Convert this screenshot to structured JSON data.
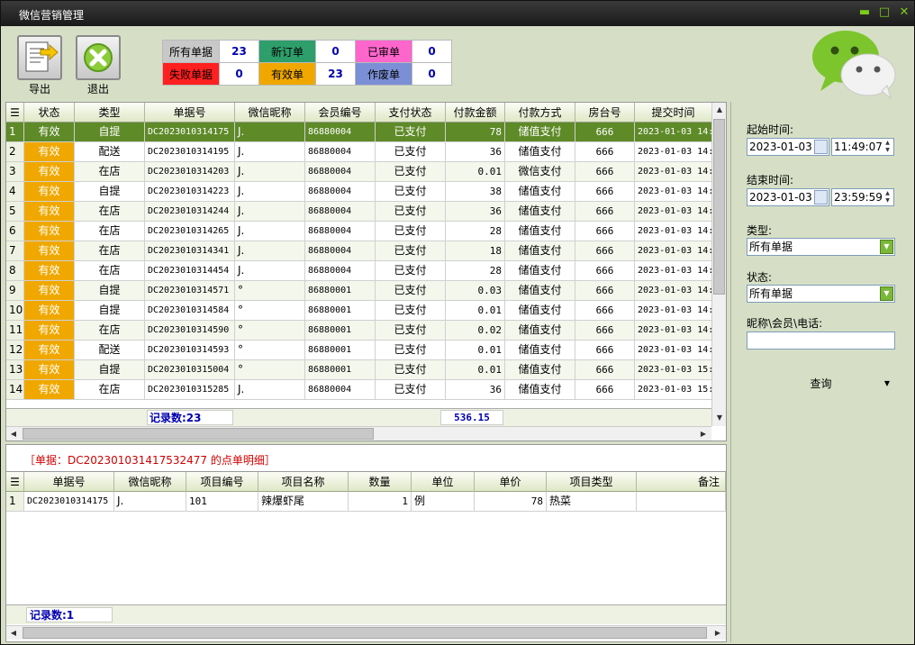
{
  "window": {
    "title": "微信营销管理",
    "min_glyph": "▬",
    "max_glyph": "□",
    "close_glyph": "✕"
  },
  "toolbar": {
    "export_label": "导出",
    "exit_label": "退出"
  },
  "stats": [
    {
      "label": "所有单据",
      "value": "23",
      "color": "#c8c8c8"
    },
    {
      "label": "新订单",
      "value": "0",
      "color": "#2e9e6b"
    },
    {
      "label": "已审单",
      "value": "0",
      "color": "#ff66cc"
    },
    {
      "label": "失败单据",
      "value": "0",
      "color": "#ff2020"
    },
    {
      "label": "有效单",
      "value": "23",
      "color": "#f0a800"
    },
    {
      "label": "作废单",
      "value": "0",
      "color": "#7b8fd6"
    }
  ],
  "orders": {
    "columns": [
      "状态",
      "类型",
      "单据号",
      "微信昵称",
      "会员编号",
      "支付状态",
      "付款金额",
      "付款方式",
      "房台号",
      "提交时间"
    ],
    "rows": [
      {
        "idx": "1",
        "status": "有效",
        "type": "自提",
        "no": "DC2023010314175",
        "nick": "J.",
        "member": "86880004",
        "pay": "已支付",
        "amount": "78",
        "way": "储值支付",
        "room": "666",
        "time": "2023-01-03 14:"
      },
      {
        "idx": "2",
        "status": "有效",
        "type": "配送",
        "no": "DC2023010314195",
        "nick": "J.",
        "member": "86880004",
        "pay": "已支付",
        "amount": "36",
        "way": "储值支付",
        "room": "666",
        "time": "2023-01-03 14:"
      },
      {
        "idx": "3",
        "status": "有效",
        "type": "在店",
        "no": "DC2023010314203",
        "nick": "J.",
        "member": "86880004",
        "pay": "已支付",
        "amount": "0.01",
        "way": "微信支付",
        "room": "666",
        "time": "2023-01-03 14:"
      },
      {
        "idx": "4",
        "status": "有效",
        "type": "自提",
        "no": "DC2023010314223",
        "nick": "J.",
        "member": "86880004",
        "pay": "已支付",
        "amount": "38",
        "way": "储值支付",
        "room": "666",
        "time": "2023-01-03 14:"
      },
      {
        "idx": "5",
        "status": "有效",
        "type": "在店",
        "no": "DC2023010314244",
        "nick": "J.",
        "member": "86880004",
        "pay": "已支付",
        "amount": "36",
        "way": "储值支付",
        "room": "666",
        "time": "2023-01-03 14:"
      },
      {
        "idx": "6",
        "status": "有效",
        "type": "在店",
        "no": "DC2023010314265",
        "nick": "J.",
        "member": "86880004",
        "pay": "已支付",
        "amount": "28",
        "way": "储值支付",
        "room": "666",
        "time": "2023-01-03 14:"
      },
      {
        "idx": "7",
        "status": "有效",
        "type": "在店",
        "no": "DC2023010314341",
        "nick": "J.",
        "member": "86880004",
        "pay": "已支付",
        "amount": "18",
        "way": "储值支付",
        "room": "666",
        "time": "2023-01-03 14:"
      },
      {
        "idx": "8",
        "status": "有效",
        "type": "在店",
        "no": "DC2023010314454",
        "nick": "J.",
        "member": "86880004",
        "pay": "已支付",
        "amount": "28",
        "way": "储值支付",
        "room": "666",
        "time": "2023-01-03 14:"
      },
      {
        "idx": "9",
        "status": "有效",
        "type": "自提",
        "no": "DC2023010314571",
        "nick": "°",
        "member": "86880001",
        "pay": "已支付",
        "amount": "0.03",
        "way": "储值支付",
        "room": "666",
        "time": "2023-01-03 14:"
      },
      {
        "idx": "10",
        "status": "有效",
        "type": "自提",
        "no": "DC2023010314584",
        "nick": "°",
        "member": "86880001",
        "pay": "已支付",
        "amount": "0.01",
        "way": "储值支付",
        "room": "666",
        "time": "2023-01-03 14:"
      },
      {
        "idx": "11",
        "status": "有效",
        "type": "在店",
        "no": "DC2023010314590",
        "nick": "°",
        "member": "86880001",
        "pay": "已支付",
        "amount": "0.02",
        "way": "储值支付",
        "room": "666",
        "time": "2023-01-03 14:"
      },
      {
        "idx": "12",
        "status": "有效",
        "type": "配送",
        "no": "DC2023010314593",
        "nick": "°",
        "member": "86880001",
        "pay": "已支付",
        "amount": "0.01",
        "way": "储值支付",
        "room": "666",
        "time": "2023-01-03 14:"
      },
      {
        "idx": "13",
        "status": "有效",
        "type": "自提",
        "no": "DC2023010315004",
        "nick": "°",
        "member": "86880001",
        "pay": "已支付",
        "amount": "0.01",
        "way": "储值支付",
        "room": "666",
        "time": "2023-01-03 15:"
      },
      {
        "idx": "14",
        "status": "有效",
        "type": "在店",
        "no": "DC2023010315285",
        "nick": "J.",
        "member": "86880004",
        "pay": "已支付",
        "amount": "36",
        "way": "储值支付",
        "room": "666",
        "time": "2023-01-03 15:"
      }
    ],
    "record_count": "记录数:23",
    "total_amount": "536.15"
  },
  "detail": {
    "title": "［单据：DC202301031417532477 的点单明细］",
    "columns": [
      "单据号",
      "微信昵称",
      "项目编号",
      "项目名称",
      "数量",
      "单位",
      "单价",
      "项目类型",
      "备注"
    ],
    "rows": [
      {
        "idx": "1",
        "no": "DC2023010314175",
        "nick": "J.",
        "code": "101",
        "name": "辣爆虾尾",
        "qty": "1",
        "unit": "例",
        "price": "78",
        "cat": "热菜",
        "note": ""
      }
    ],
    "record_count": "记录数:1"
  },
  "panel": {
    "start_label": "起始时间:",
    "start_date": "2023-01-03",
    "start_time": "11:49:07",
    "end_label": "结束时间:",
    "end_date": "2023-01-03",
    "end_time": "23:59:59",
    "type_label": "类型:",
    "type_value": "所有单据",
    "status_label": "状态:",
    "status_value": "所有单据",
    "search_label": "昵称\\会员\\电话:",
    "search_value": "",
    "query_label": "查询"
  }
}
